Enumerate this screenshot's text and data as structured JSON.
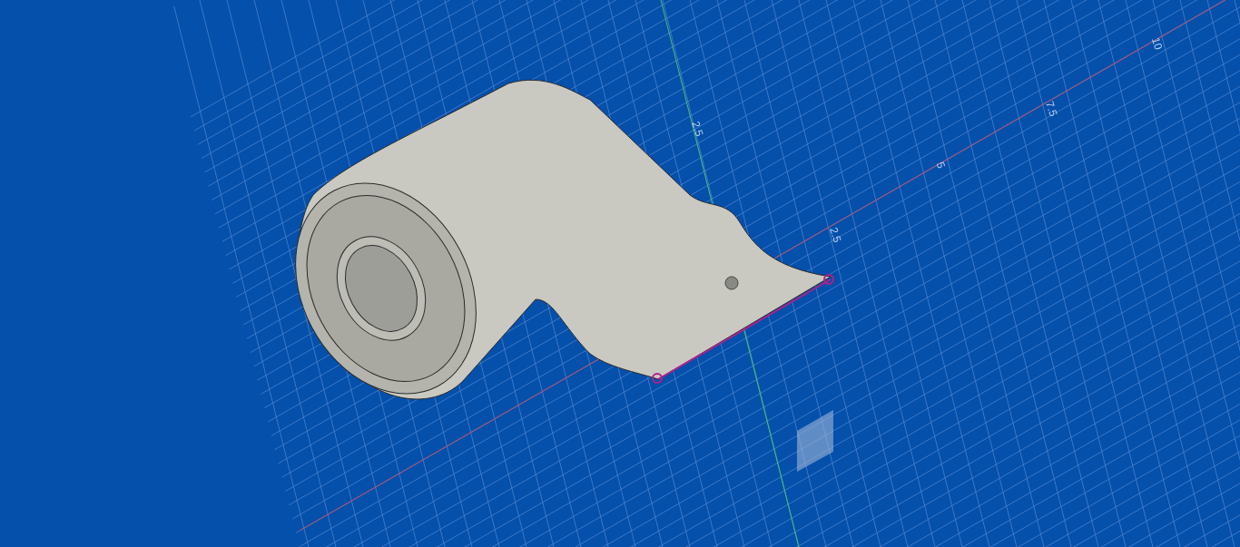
{
  "viewport": {
    "grid_labels": [
      {
        "text": "2.5"
      },
      {
        "text": "2.5"
      },
      {
        "text": "5"
      },
      {
        "text": "7.5"
      },
      {
        "text": "10"
      }
    ]
  }
}
